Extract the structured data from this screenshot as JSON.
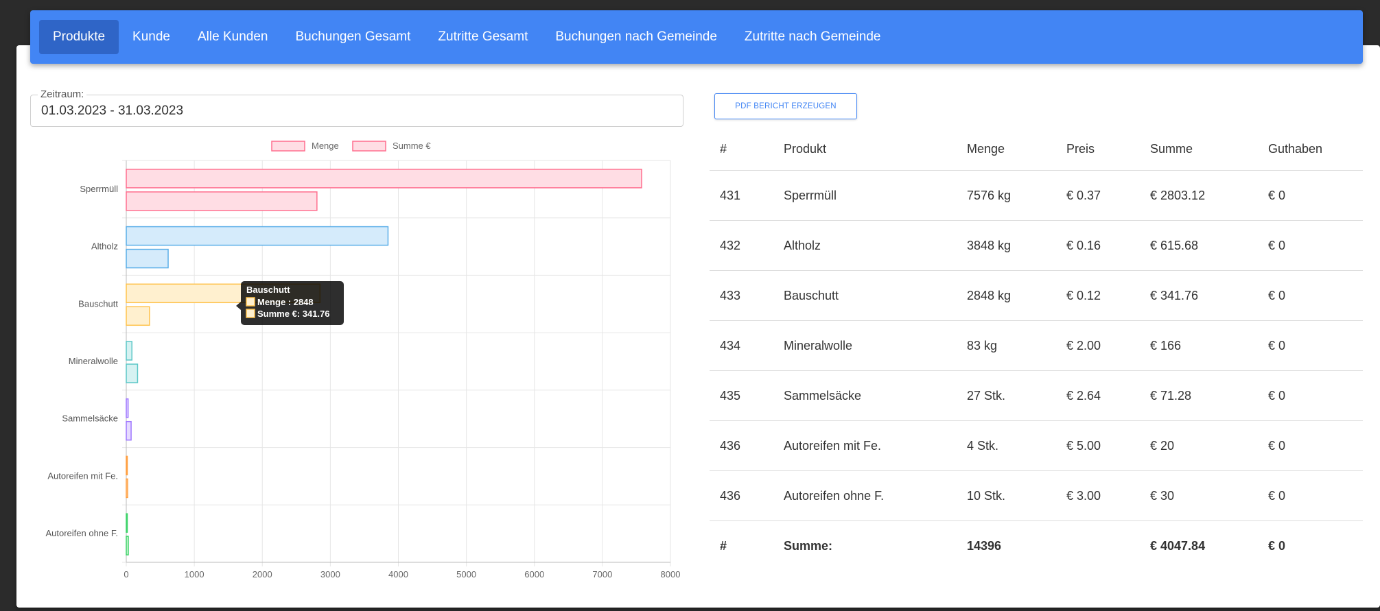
{
  "nav": {
    "items": [
      "Produkte",
      "Kunde",
      "Alle Kunden",
      "Buchungen Gesamt",
      "Zutritte Gesamt",
      "Buchungen nach Gemeinde",
      "Zutritte nach Gemeinde"
    ],
    "active": 0
  },
  "filter": {
    "label": "Zeitraum:",
    "value": "01.03.2023 - 31.03.2023"
  },
  "pdf_button": "PDF BERICHT ERZEUGEN",
  "table": {
    "headers": [
      "#",
      "Produkt",
      "Menge",
      "Preis",
      "Summe",
      "Guthaben"
    ],
    "rows": [
      [
        "431",
        "Sperrmüll",
        "7576 kg",
        "€ 0.37",
        "€ 2803.12",
        "€ 0"
      ],
      [
        "432",
        "Altholz",
        "3848 kg",
        "€ 0.16",
        "€ 615.68",
        "€ 0"
      ],
      [
        "433",
        "Bauschutt",
        "2848 kg",
        "€ 0.12",
        "€ 341.76",
        "€ 0"
      ],
      [
        "434",
        "Mineralwolle",
        "83 kg",
        "€ 2.00",
        "€ 166",
        "€ 0"
      ],
      [
        "435",
        "Sammelsäcke",
        "27 Stk.",
        "€ 2.64",
        "€ 71.28",
        "€ 0"
      ],
      [
        "436",
        "Autoreifen mit Fe.",
        "4 Stk.",
        "€ 5.00",
        "€ 20",
        "€ 0"
      ],
      [
        "436",
        "Autoreifen ohne F.",
        "10 Stk.",
        "€ 3.00",
        "€ 30",
        "€ 0"
      ]
    ],
    "footer": [
      "#",
      "Summe:",
      "14396",
      "",
      "€ 4047.84",
      "€ 0"
    ]
  },
  "chart_data": {
    "type": "bar",
    "orientation": "horizontal",
    "categories": [
      "Sperrmüll",
      "Altholz",
      "Bauschutt",
      "Mineralwolle",
      "Sammelsäcke",
      "Autoreifen mit Fe.",
      "Autoreifen ohne F."
    ],
    "series": [
      {
        "name": "Menge",
        "values": [
          7576,
          3848,
          2848,
          83,
          27,
          4,
          10
        ]
      },
      {
        "name": "Summe €",
        "values": [
          2803.12,
          615.68,
          341.76,
          166,
          71.28,
          20,
          30
        ]
      }
    ],
    "category_colors": [
      {
        "fill": "#ffdde4",
        "stroke": "#ff6f8f"
      },
      {
        "fill": "#d5ebfb",
        "stroke": "#5aaee8"
      },
      {
        "fill": "#fff0cf",
        "stroke": "#ffc34d"
      },
      {
        "fill": "#d6f2f2",
        "stroke": "#5cc7c7"
      },
      {
        "fill": "#e6dbff",
        "stroke": "#9f78ff"
      },
      {
        "fill": "#ffe6cc",
        "stroke": "#ff9f40"
      },
      {
        "fill": "#d5f7da",
        "stroke": "#3ed36a"
      }
    ],
    "xlim": [
      0,
      8000
    ],
    "xticks": [
      0,
      1000,
      2000,
      3000,
      4000,
      5000,
      6000,
      7000,
      8000
    ],
    "legend_position": "top",
    "grid": true,
    "tooltip": {
      "title": "Bauschutt",
      "lines": [
        "Menge : 2848",
        "Summe €: 341.76"
      ],
      "category_index": 2
    }
  }
}
